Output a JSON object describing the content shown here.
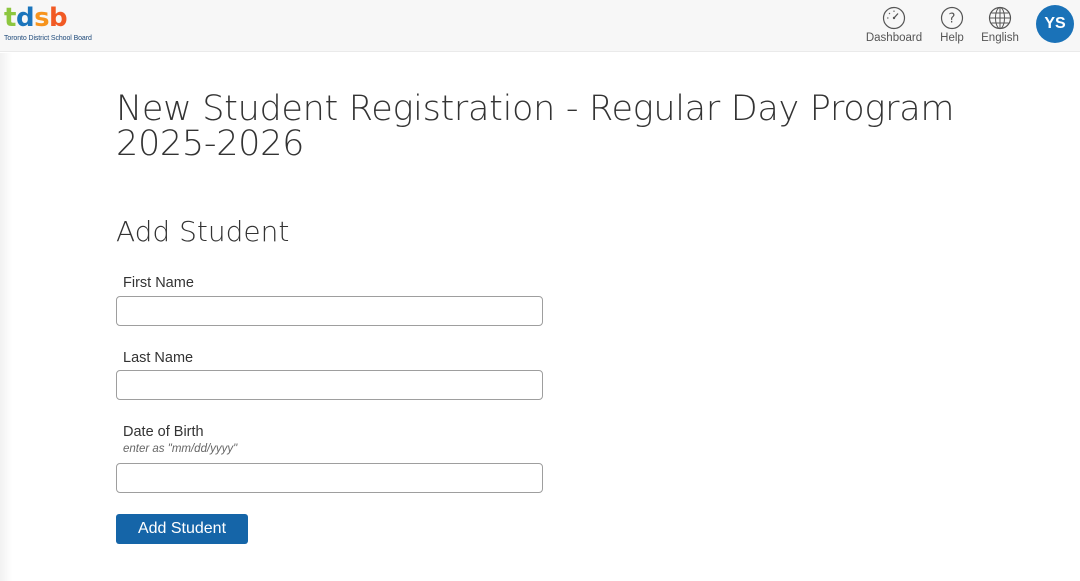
{
  "brand": {
    "logo_letters": [
      "t",
      "d",
      "s",
      "b"
    ],
    "logo_colors": [
      "#8dc63f",
      "#1b75bc",
      "#f7941d",
      "#f15a24"
    ],
    "subtitle": "Toronto District School Board"
  },
  "header": {
    "nav": [
      {
        "label": "Dashboard",
        "icon": "dashboard-gauge-icon"
      },
      {
        "label": "Help",
        "icon": "help-question-icon"
      },
      {
        "label": "English",
        "icon": "globe-icon"
      }
    ],
    "user_initials": "YS",
    "accent": "#1a72b8"
  },
  "page": {
    "title": "New Student Registration - Regular Day Program 2025-2026",
    "section_title": "Add Student"
  },
  "form": {
    "first_name": {
      "label": "First Name",
      "value": ""
    },
    "last_name": {
      "label": "Last Name",
      "value": ""
    },
    "dob": {
      "label": "Date of Birth",
      "hint": "enter as \"mm/dd/yyyy\"",
      "value": ""
    },
    "submit_label": "Add Student",
    "button_color": "#1565a8"
  }
}
